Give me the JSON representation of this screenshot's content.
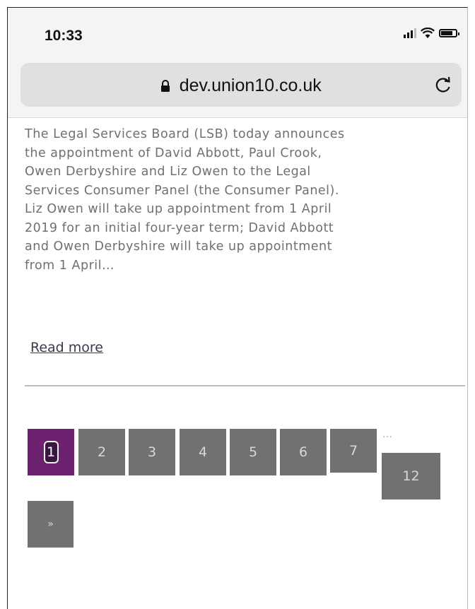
{
  "status_bar": {
    "time": "10:33"
  },
  "browser": {
    "url": "dev.union10.co.uk"
  },
  "article": {
    "lines": [
      "The Legal Services Board (LSB) today announces",
      "the appointment of David Abbott, Paul Crook,",
      "Owen Derbyshire and Liz Owen to the Legal",
      "Services Consumer Panel (the Consumer Panel).",
      "Liz Owen will take up appointment from 1 April",
      "2019 for an initial four-year term; David Abbott",
      "and Owen Derbyshire will take up appointment",
      "from 1 April…"
    ],
    "read_more": "Read more"
  },
  "pagination": {
    "pages": [
      "1",
      "2",
      "3",
      "4",
      "5",
      "6",
      "7"
    ],
    "current": "1",
    "ellipsis": "…",
    "last": "12",
    "next": "»",
    "colors": {
      "active": "#6d2270",
      "inactive": "#727170"
    }
  }
}
